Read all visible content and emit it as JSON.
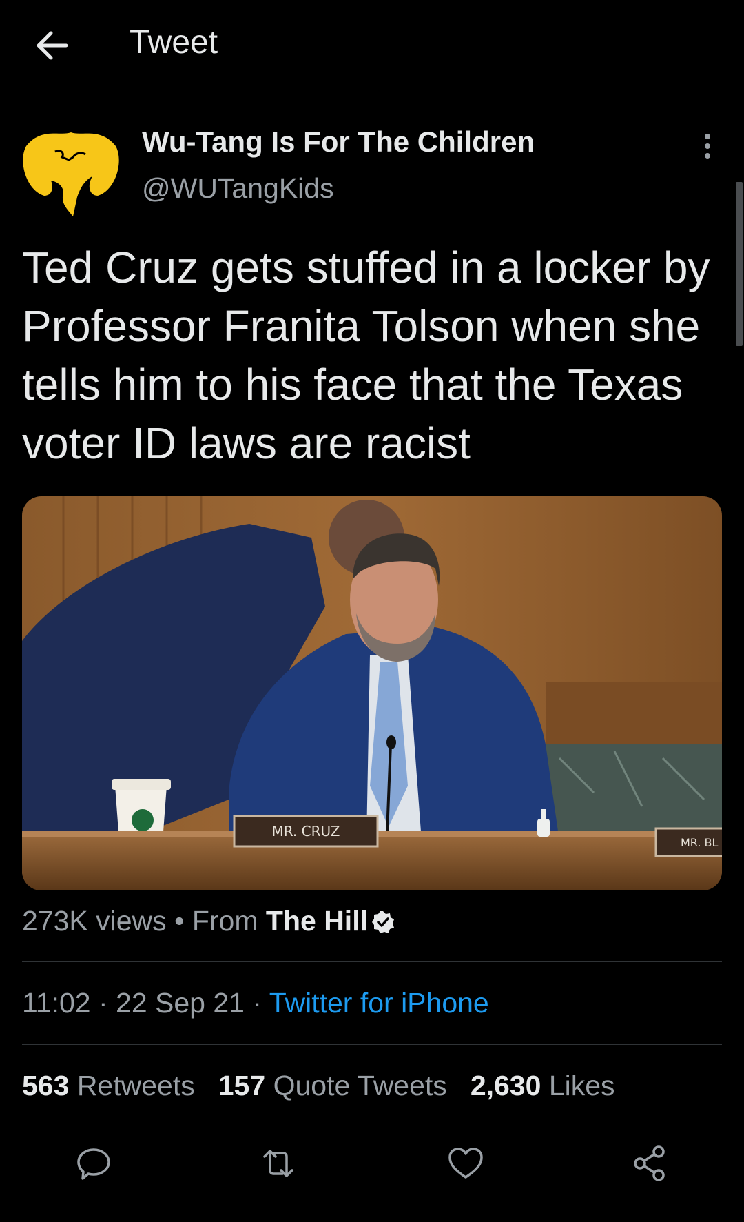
{
  "header": {
    "title": "Tweet",
    "back_icon": "arrow-left-icon"
  },
  "author": {
    "name": "Wu-Tang Is For The Children",
    "handle": "@WUTangKids",
    "avatar_icon": "wu-tang-logo-avatar",
    "avatar_color": "#f7c618",
    "more_icon": "more-vertical-icon"
  },
  "tweet": {
    "text": "Ted Cruz gets stuffed in a locker by Professor Franita Tolson when she tells him to his face that the Texas voter ID laws are racist"
  },
  "media": {
    "nameplate_1": "MR. CRUZ",
    "nameplate_2": "MR. BL"
  },
  "meta": {
    "views": "273K views",
    "separator": "•",
    "from_label": "From",
    "source": "The Hill",
    "verified_icon": "verified-badge-icon"
  },
  "timestamp": {
    "time": "11:02",
    "dot1": "·",
    "date": "22 Sep 21",
    "dot2": "·",
    "client": "Twitter for iPhone"
  },
  "stats": {
    "retweets_count": "563",
    "retweets_label": "Retweets",
    "quotes_count": "157",
    "quotes_label": "Quote Tweets",
    "likes_count": "2,630",
    "likes_label": "Likes"
  },
  "actions": [
    "reply-icon",
    "retweet-icon",
    "like-icon",
    "share-icon"
  ],
  "colors": {
    "background": "#000000",
    "link": "#1d9bf0",
    "muted": "#9aa0a6",
    "divider": "#2f3336"
  }
}
